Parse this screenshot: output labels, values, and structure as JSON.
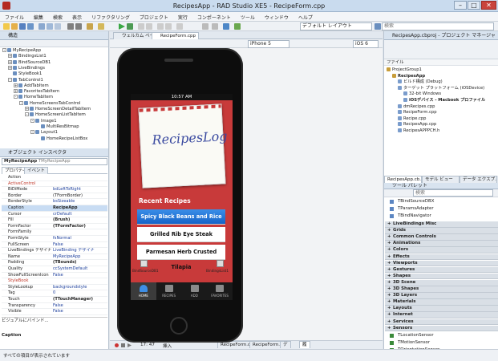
{
  "window": {
    "title": "RecipesApp - RAD Studio XE5 - RecipeForm.cpp"
  },
  "menu": [
    "ファイル",
    "編集",
    "検索",
    "表示",
    "リファクタリング",
    "プロジェクト",
    "実行",
    "コンポーネント",
    "ツール",
    "ウィンドウ",
    "ヘルプ"
  ],
  "toolbar": {
    "layout_combo": "デフォルト レイアウト",
    "search_placeholder": "検索"
  },
  "structure": {
    "title": "構造",
    "nodes": [
      {
        "label": "MyRecipeApp",
        "depth": 0,
        "exp": "-"
      },
      {
        "label": "BindingsList1",
        "depth": 1,
        "exp": "+"
      },
      {
        "label": "BindSourceDB1",
        "depth": 1,
        "exp": "+"
      },
      {
        "label": "LiveBindings",
        "depth": 1,
        "exp": "+"
      },
      {
        "label": "StyleBook1",
        "depth": 1,
        "exp": ""
      },
      {
        "label": "TabControl1",
        "depth": 1,
        "exp": "-"
      },
      {
        "label": "AddTabItem",
        "depth": 2,
        "exp": "+"
      },
      {
        "label": "FavoritesTabItem",
        "depth": 2,
        "exp": "+"
      },
      {
        "label": "HomeTabItem",
        "depth": 2,
        "exp": "-"
      },
      {
        "label": "HomeScreensTabControl",
        "depth": 3,
        "exp": "-"
      },
      {
        "label": "HomeScreenDetailTabItem",
        "depth": 4,
        "exp": "+"
      },
      {
        "label": "HomeScreenListTabItem",
        "depth": 4,
        "exp": "-"
      },
      {
        "label": "Image1",
        "depth": 5,
        "exp": "-"
      },
      {
        "label": "MultiResBitmap",
        "depth": 6,
        "exp": ""
      },
      {
        "label": "Layout1",
        "depth": 5,
        "exp": "-"
      },
      {
        "label": "HomeRecipeListBox",
        "depth": 6,
        "exp": ""
      }
    ]
  },
  "inspector": {
    "title": "オブジェクト インスペクタ",
    "object": "MyRecipeApp",
    "object_type": "TMyRecipeApp",
    "tabs": [
      "プロパティ",
      "イベント"
    ],
    "rows": [
      {
        "k": "Action",
        "v": ""
      },
      {
        "k": "ActiveControl",
        "v": ""
      },
      {
        "k": "BiDiMode",
        "v": "bdLeftToRight"
      },
      {
        "k": "Border",
        "v": "(TFormBorder)"
      },
      {
        "k": "BorderStyle",
        "v": "bsSizeable"
      },
      {
        "k": "Caption",
        "v": "RecipeApp",
        "bold": true,
        "sel": true
      },
      {
        "k": "Cursor",
        "v": "crDefault"
      },
      {
        "k": "Fill",
        "v": "(Brush)",
        "bold": true
      },
      {
        "k": "FormFactor",
        "v": "(TFormFactor)",
        "bold": true
      },
      {
        "k": "FormFamily",
        "v": ""
      },
      {
        "k": "FormStyle",
        "v": "fsNormal"
      },
      {
        "k": "FullScreen",
        "v": "False"
      },
      {
        "k": "LiveBindings デザイナ",
        "v": "LiveBinding デザイナ"
      },
      {
        "k": "Name",
        "v": "MyRecipeApp"
      },
      {
        "k": "Padding",
        "v": "(TBounds)",
        "bold": true
      },
      {
        "k": "Quality",
        "v": "ccSystemDefault"
      },
      {
        "k": "ShowFullScreenIcon",
        "v": "False"
      },
      {
        "k": "StyleBook",
        "v": ""
      },
      {
        "k": "StyleLookup",
        "v": "backgroundstyle"
      },
      {
        "k": "Tag",
        "v": "0"
      },
      {
        "k": "Touch",
        "v": "(TTouchManager)",
        "bold": true
      },
      {
        "k": "Transparency",
        "v": "False"
      },
      {
        "k": "Visible",
        "v": "False"
      }
    ],
    "footer_label": "ビジュアルにバインド...",
    "desc_title": "Caption",
    "status_text": "すべての項目が表示されています"
  },
  "editor": {
    "tabs": [
      "ウェルカム ページ",
      "RecipeForm.cpp"
    ],
    "device_combo": "iPhone 5",
    "os_combo": "iOS 6",
    "bottom_tabs": [
      "RecipeForm.cpp",
      "RecipeForm.h",
      "デザイン",
      "履歴"
    ],
    "cursor_pos": "17: 47",
    "insert_mode": "挿入"
  },
  "phone": {
    "time": "10:57 AM",
    "logo_text": "RecipesLog",
    "section_title": "Recent Recipes",
    "recipes": [
      "Spicy Black Beans and Rice",
      "Grilled Rib Eye Steak",
      "Parmesan Herb Crusted Tilapia"
    ],
    "comp_labels": [
      "BindSourceDB1",
      "BindingsList1"
    ],
    "tabs": [
      "HOME",
      "RECIPES",
      "ADD",
      "FAVORITES"
    ]
  },
  "project_manager": {
    "title": "RecipesApp.cbproj - プロジェクト マネージャ",
    "file_label": "ファイル",
    "nodes": [
      {
        "label": "ProjectGroup1",
        "depth": 0
      },
      {
        "label": "RecipesApp",
        "depth": 1,
        "bold": true
      },
      {
        "label": "ビルド構成 (Debug)",
        "depth": 2
      },
      {
        "label": "ターゲット プラットフォーム (iOSDevice)",
        "depth": 2
      },
      {
        "label": "32-bit Windows",
        "depth": 3
      },
      {
        "label": "iOSデバイス - Macbook プロファイル",
        "depth": 3,
        "bold": true
      },
      {
        "label": "dmRecipes.cpp",
        "depth": 2
      },
      {
        "label": "RecipeForm.cpp",
        "depth": 2
      },
      {
        "label": "Recipe.cpp",
        "depth": 2
      },
      {
        "label": "RecipesApp.cpp",
        "depth": 2
      },
      {
        "label": "RecipesAPPPCH.h",
        "depth": 2
      }
    ],
    "tabs": [
      "RecipesApp.cb...",
      "モデル ビュー",
      "データ エクスプ..."
    ]
  },
  "tool_palette": {
    "title": "ツール パレット",
    "search_placeholder": "検索",
    "top_items": [
      "TBindSourceDBX",
      "TParamsAdapter",
      "TBindNavigator"
    ],
    "categories": [
      "LiveBindings Misc",
      "Grids",
      "Common Controls",
      "Animations",
      "Colors",
      "Effects",
      "Viewports",
      "Gestures",
      "Shapes",
      "3D Scene",
      "3D Shapes",
      "3D Layers",
      "Materials",
      "Layouts",
      "Internet",
      "Services",
      "Sensors"
    ],
    "sensor_items": [
      "TLocationSensor",
      "TMotionSensor",
      "TOrientationSensor"
    ]
  }
}
